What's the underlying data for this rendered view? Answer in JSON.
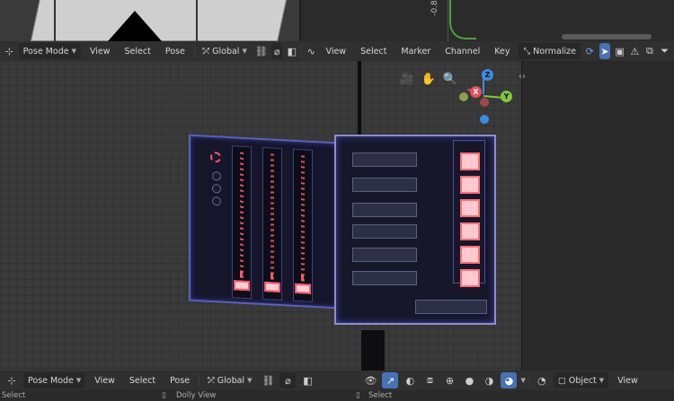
{
  "top_graph": {
    "y_label": "-0.8"
  },
  "header_top": {
    "mode": "Pose Mode",
    "menus": [
      "View",
      "Select",
      "Pose"
    ],
    "transform_orientation": "Global",
    "graph_menus": [
      "View",
      "Select",
      "Marker",
      "Channel",
      "Key"
    ],
    "normalize_label": "Normalize"
  },
  "header_bottom": {
    "mode": "Pose Mode",
    "menus": [
      "View",
      "Select",
      "Pose"
    ],
    "transform_orientation": "Global",
    "object_mode": "Object",
    "right_menus": [
      "View"
    ]
  },
  "gizmo": {
    "x": "X",
    "y": "Y",
    "z": "Z"
  },
  "status_bar": {
    "left": "Select",
    "middle": "Dolly View",
    "right": "Select"
  },
  "colors": {
    "accent": "#4772b3",
    "axis_x": "#e84d5c",
    "axis_y": "#7ec93a",
    "axis_z": "#3c8be4",
    "glow": "#ff5a68"
  }
}
